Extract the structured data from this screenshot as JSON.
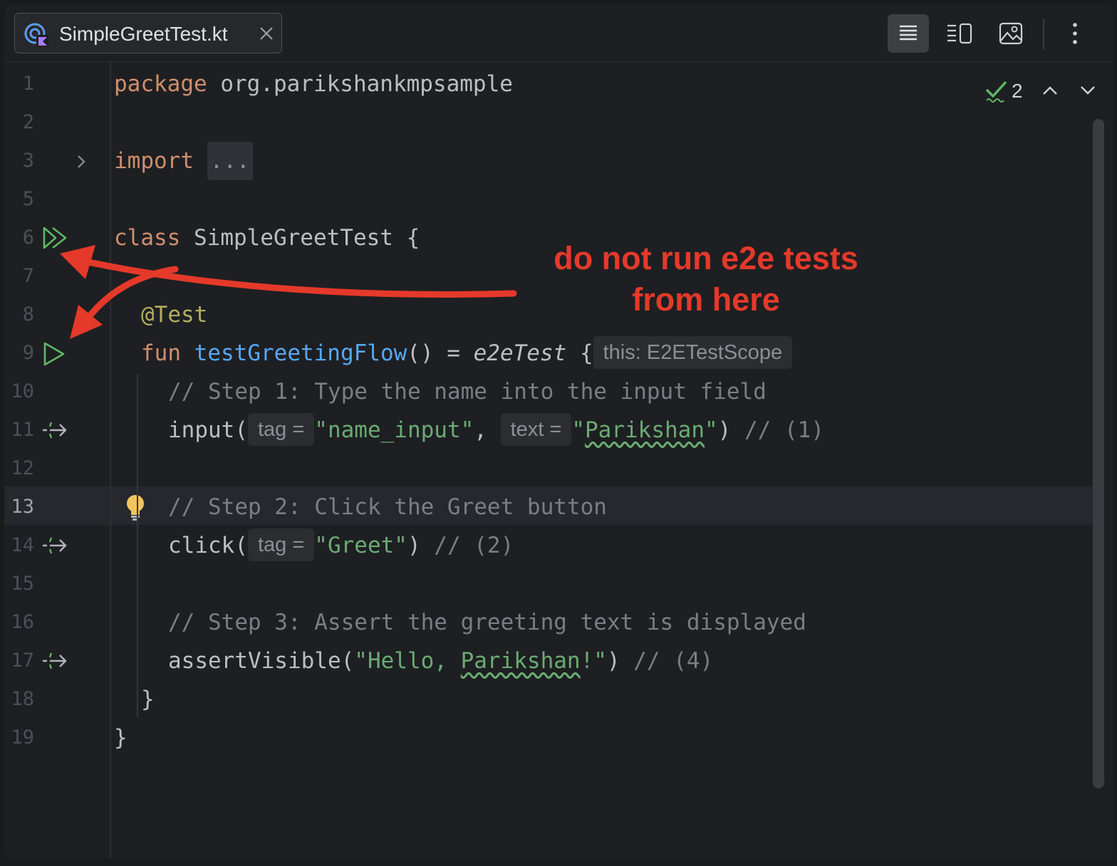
{
  "tab": {
    "filename": "SimpleGreetTest.kt",
    "file_icon": "kotlin-test-file-icon",
    "close_icon": "close-icon"
  },
  "toolbar": {
    "icons": [
      "reader-mode-icon",
      "split-view-icon",
      "image-preview-icon",
      "more-icon"
    ]
  },
  "inspections": {
    "count": "2",
    "icon": "check-icon"
  },
  "lines": [
    {
      "n": "1"
    },
    {
      "n": "2"
    },
    {
      "n": "3"
    },
    {
      "n": "5"
    },
    {
      "n": "6"
    },
    {
      "n": "7"
    },
    {
      "n": "8"
    },
    {
      "n": "9"
    },
    {
      "n": "10"
    },
    {
      "n": "11"
    },
    {
      "n": "12"
    },
    {
      "n": "13"
    },
    {
      "n": "14"
    },
    {
      "n": "15"
    },
    {
      "n": "16"
    },
    {
      "n": "17"
    },
    {
      "n": "18"
    },
    {
      "n": "19"
    }
  ],
  "code": {
    "l1_kw": "package",
    "l1_rest": " org.parikshankmpsample",
    "l3_kw": "import",
    "l3_fold": "...",
    "l6_kw": "class",
    "l6_rest": " SimpleGreetTest {",
    "l8_ann": "@Test",
    "l9_kw": "fun",
    "l9_fn": "testGreetingFlow",
    "l9_mid": "() = ",
    "l9_call": "e2eTest",
    "l9_brace": " {",
    "l9_hint": "this: E2ETestScope",
    "l10_cmt": "// Step 1: Type the name into the input field",
    "l11_a": "input(",
    "l11_hint1": "tag =",
    "l11_str1": "\"name_input\"",
    "l11_comma": ", ",
    "l11_hint2": "text =",
    "l11_q1": "\"",
    "l11_typo": "Parikshan",
    "l11_q2": "\"",
    "l11_close": ") ",
    "l11_cmt": "// (1)",
    "l13_cmt": "// Step 2: Click the Greet button",
    "l14_a": "click(",
    "l14_hint": "tag =",
    "l14_str": "\"Greet\"",
    "l14_close": ") ",
    "l14_cmt": "// (2)",
    "l16_cmt": "// Step 3: Assert the greeting text is displayed",
    "l17_a": "assertVisible(",
    "l17_str1": "\"Hello, ",
    "l17_typo": "Parikshan",
    "l17_str2": "!\"",
    "l17_close": ") ",
    "l17_cmt": "// (4)",
    "l18": "}",
    "l19": "}"
  },
  "gutter_icons": {
    "fold": "chevron-right-icon",
    "run_class": "run-all-icon",
    "run_test": "run-icon",
    "step": "step-marker-icon",
    "bulb": "lightbulb-icon"
  },
  "annotation": {
    "line1": "do not run e2e tests",
    "line2": "from here",
    "color": "#e5392a"
  },
  "colors": {
    "keyword": "#cf8e6d",
    "string": "#6aab73",
    "comment": "#7a7e85",
    "function": "#56a8f5",
    "annotation": "#b3ae60",
    "run": "#5fb865"
  }
}
